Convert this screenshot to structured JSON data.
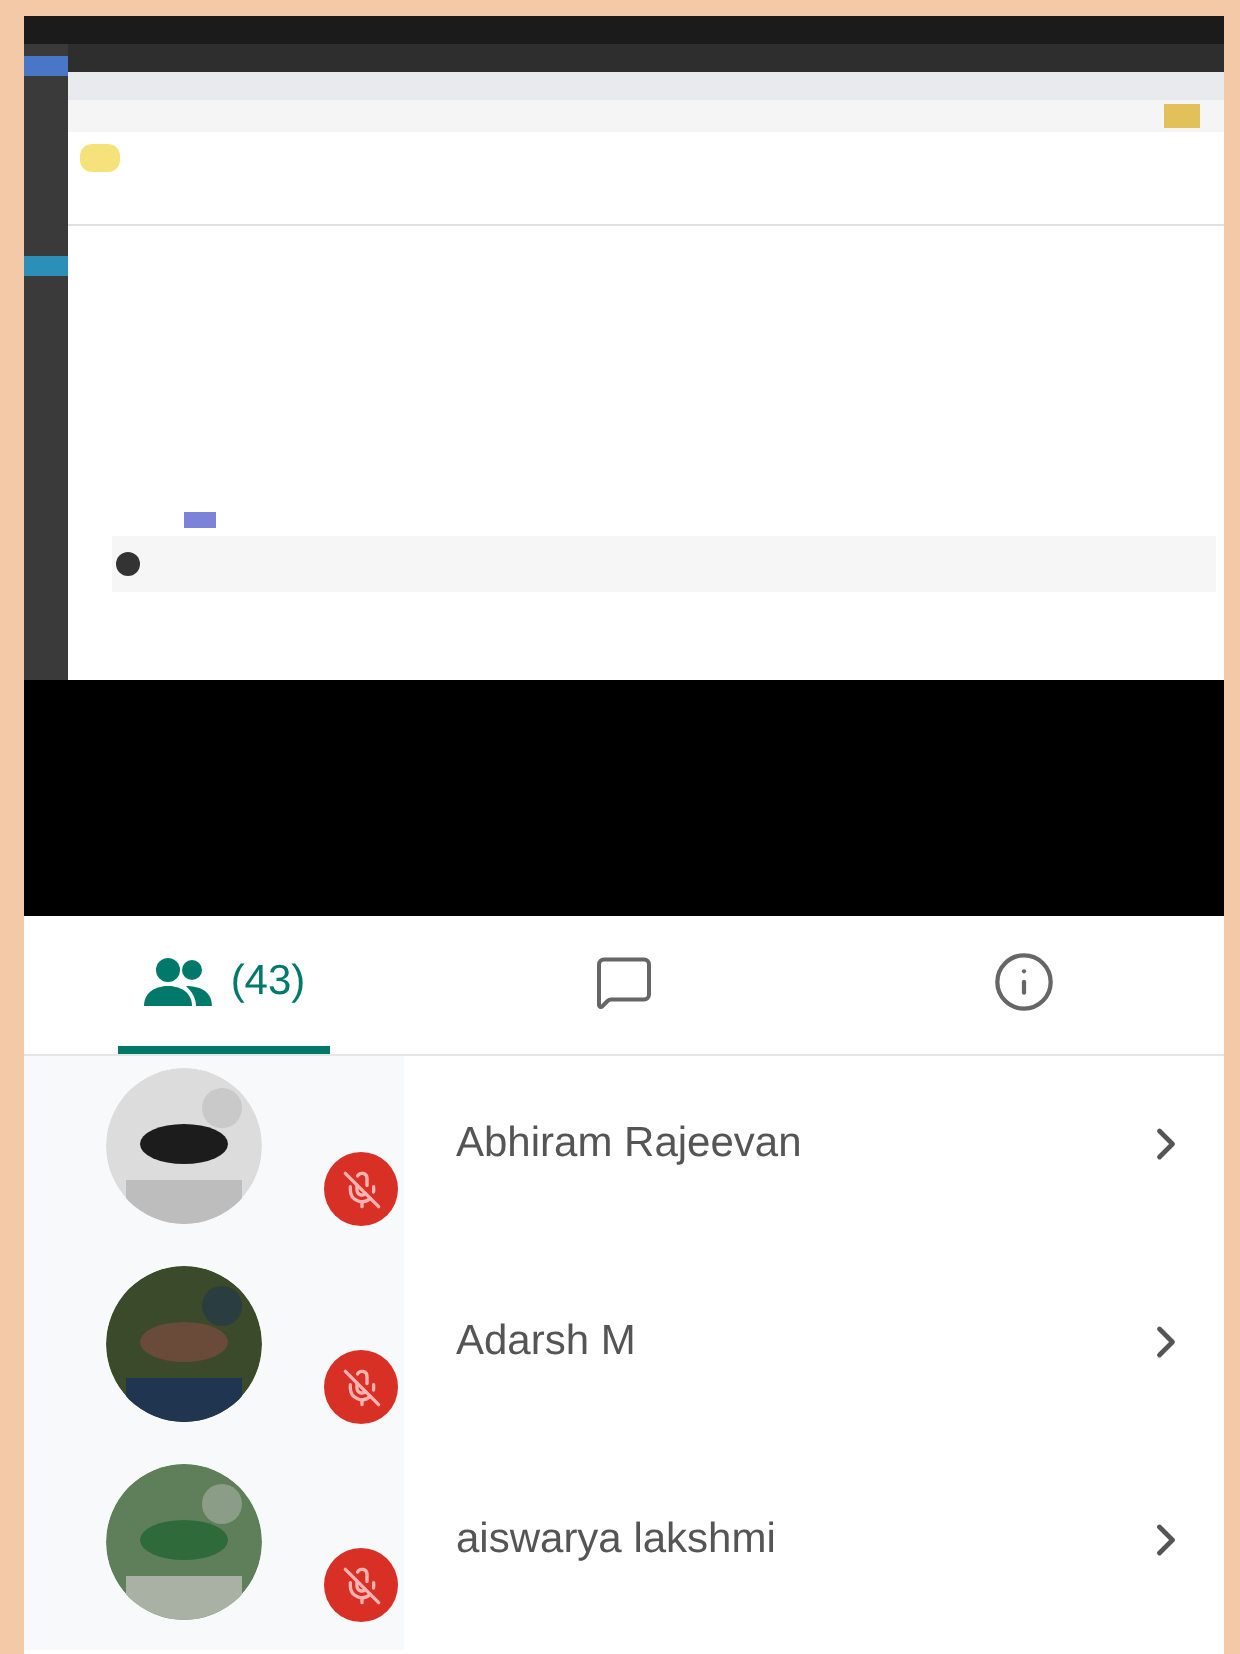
{
  "tabs": [
    {
      "kind": "people",
      "label": "(43)",
      "selected": true
    },
    {
      "kind": "chat",
      "selected": false
    },
    {
      "kind": "info",
      "selected": false
    }
  ],
  "participants": [
    {
      "name": "Abhiram Rajeevan",
      "muted": true
    },
    {
      "name": "Adarsh M",
      "muted": true
    },
    {
      "name": "aiswarya lakshmi",
      "muted": true
    }
  ]
}
